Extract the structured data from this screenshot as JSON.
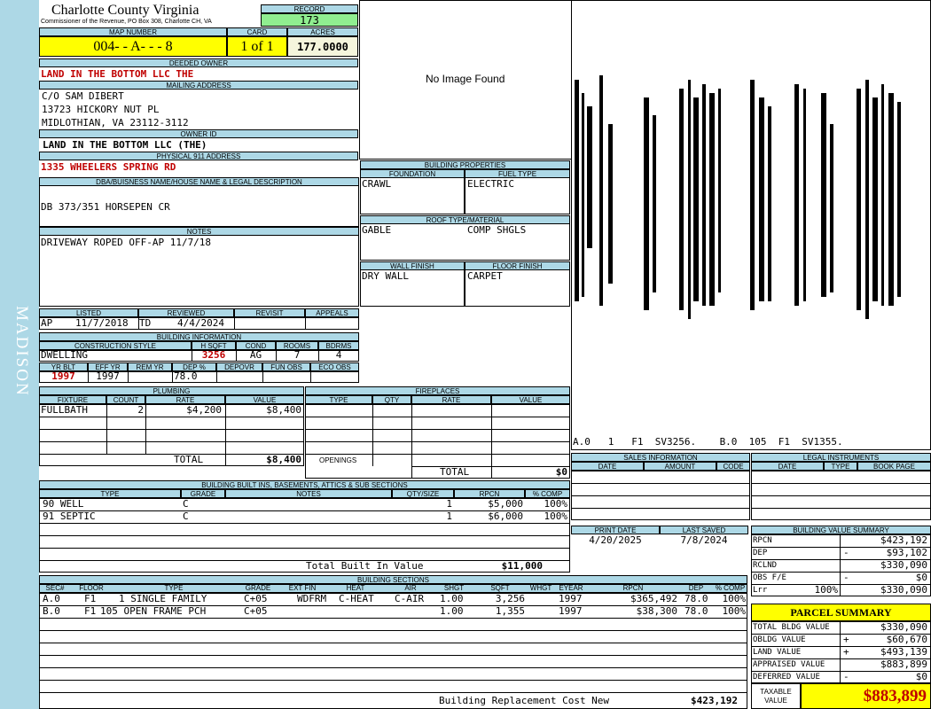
{
  "sidebar_label": "MADISON",
  "header": {
    "county": "Charlotte County Virginia",
    "commissioner": "Commissioner of the Revenue, PO Box 308, Charlotte CH, VA",
    "record_label": "RECORD",
    "record": "173",
    "map_number_label": "MAP NUMBER",
    "map_number": "004-  - A-  -  -  8",
    "card_label": "CARD",
    "card": "1 of 1",
    "acres_label": "ACRES",
    "acres": "177.0000"
  },
  "owner": {
    "deeded_owner_label": "DEEDED OWNER",
    "deeded_owner": "LAND IN THE BOTTOM LLC  THE",
    "mailing_address_label": "MAILING ADDRESS",
    "mailing_lines": [
      "C/O SAM DIBERT",
      "13723 HICKORY NUT PL",
      "MIDLOTHIAN, VA 23112-3112"
    ],
    "owner_id_label": "OWNER ID",
    "owner_id": "LAND IN THE BOTTOM LLC (THE)",
    "physical_address_label": "PHYSICAL 911 ADDRESS",
    "physical_address": "1335 WHEELERS SPRING RD",
    "dba_label": "DBA/BUISNESS NAME/HOUSE NAME & LEGAL DESCRIPTION",
    "dba": "DB 373/351 HORSEPEN CR",
    "notes_label": "NOTES",
    "notes": "DRIVEWAY ROPED OFF-AP 11/7/18"
  },
  "image_placeholder": "No Image Found",
  "building_properties": {
    "label": "BUILDING PROPERTIES",
    "foundation_label": "FOUNDATION",
    "foundation": "CRAWL",
    "fuel_label": "FUEL TYPE",
    "fuel": "ELECTRIC",
    "roof_label": "ROOF TYPE/MATERIAL",
    "roof_type": "GABLE",
    "roof_material": "COMP SHGLS",
    "wall_label": "WALL FINISH",
    "wall": "DRY WALL",
    "floor_label": "FLOOR FINISH",
    "floor": "CARPET"
  },
  "sketch_caption": "A.0   1   F1  SV3256.    B.0  105  F1  SV1355.",
  "listing": {
    "listed_label": "LISTED",
    "listed_by": "AP",
    "listed_date": "11/7/2018",
    "reviewed_label": "REVIEWED",
    "reviewed_by": "TD",
    "reviewed_date": "4/4/2024",
    "revisit_label": "REVISIT",
    "appeals_label": "APPEALS"
  },
  "building_info": {
    "label": "BUILDING INFORMATION",
    "style_label": "CONSTRUCTION STYLE",
    "style": "DWELLING",
    "hsqft_label": "H SQFT",
    "hsqft": "3256",
    "cond_label": "COND",
    "cond": "AG",
    "rooms_label": "ROOMS",
    "rooms": "7",
    "bdrms_label": "BDRMS",
    "bdrms": "4",
    "yrblt_label": "YR BLT",
    "yrblt": "1997",
    "effyr_label": "EFF YR",
    "effyr": "1997",
    "remyr_label": "REM YR",
    "remyr": "",
    "dep_label": "DEP %",
    "dep": "78.0",
    "depovr_label": "DEPOVR",
    "funobs_label": "FUN OBS",
    "ecoobs_label": "ECO OBS"
  },
  "plumbing": {
    "label": "PLUMBING",
    "headers": [
      "FIXTURE",
      "COUNT",
      "RATE",
      "VALUE"
    ],
    "rows": [
      [
        "FULLBATH",
        "2",
        "$4,200",
        "$8,400"
      ]
    ],
    "total_label": "TOTAL",
    "total": "$8,400"
  },
  "fireplaces": {
    "label": "FIREPLACES",
    "headers": [
      "TYPE",
      "QTY",
      "RATE",
      "VALUE"
    ],
    "openings_label": "OPENINGS",
    "total_label": "TOTAL",
    "total": "$0"
  },
  "sales": {
    "label": "SALES INFORMATION",
    "headers": [
      "DATE",
      "AMOUNT",
      "CODE"
    ]
  },
  "legal": {
    "label": "LEGAL INSTRUMENTS",
    "headers": [
      "DATE",
      "TYPE",
      "BOOK PAGE"
    ]
  },
  "dates": {
    "print_label": "PRINT DATE",
    "print_date": "4/20/2025",
    "saved_label": "LAST SAVED",
    "saved_date": "7/8/2024"
  },
  "built_ins": {
    "label": "BUILDING BUILT INS, BASEMENTS, ATTICS & SUB SECTIONS",
    "headers": [
      "TYPE",
      "GRADE",
      "NOTES",
      "QTY/SIZE",
      "RPCN",
      "% COMP"
    ],
    "rows": [
      [
        "90 WELL",
        "C",
        "",
        "1",
        "$5,000",
        "100%"
      ],
      [
        "91 SEPTIC",
        "C",
        "",
        "1",
        "$6,000",
        "100%"
      ]
    ],
    "total_label": "Total Built In Value",
    "total": "$11,000"
  },
  "value_summary": {
    "label": "BUILDING VALUE SUMMARY",
    "rows": [
      {
        "name": "RPCN",
        "pct": "",
        "sign": "",
        "value": "$423,192"
      },
      {
        "name": "DEP",
        "pct": "",
        "sign": "-",
        "value": "$93,102"
      },
      {
        "name": "RCLND",
        "pct": "",
        "sign": "",
        "value": "$330,090"
      },
      {
        "name": "OBS F/E",
        "pct": "",
        "sign": "-",
        "value": "$0"
      },
      {
        "name": "Lrr",
        "pct": "100%",
        "sign": "",
        "value": "$330,090"
      }
    ]
  },
  "sections": {
    "label": "BUILDING SECTIONS",
    "headers": [
      "SEC#",
      "FLOOR",
      "TYPE",
      "GRADE",
      "EXT FIN",
      "HEAT",
      "AIR",
      "SHGT",
      "SQFT",
      "WHGT",
      "EYEAR",
      "RPCN",
      "DEP",
      "% COMP"
    ],
    "rows": [
      [
        "A.0",
        "F1",
        "1 SINGLE FAMILY",
        "C+05",
        "WDFRM",
        "C-HEAT",
        "C-AIR",
        "1.00",
        "3,256",
        "",
        "1997",
        "$365,492",
        "78.0",
        "100%"
      ],
      [
        "B.0",
        "F1",
        "105 OPEN FRAME PCH",
        "C+05",
        "",
        "",
        "",
        "1.00",
        "1,355",
        "",
        "1997",
        "$38,300",
        "78.0",
        "100%"
      ]
    ],
    "total_label": "Building Replacement Cost New",
    "total": "$423,192"
  },
  "parcel_summary": {
    "label": "PARCEL SUMMARY",
    "rows": [
      {
        "name": "TOTAL BLDG VALUE",
        "sign": "",
        "value": "$330,090"
      },
      {
        "name": "OBLDG VALUE",
        "sign": "+",
        "value": "$60,670"
      },
      {
        "name": "LAND VALUE",
        "sign": "+",
        "value": "$493,139"
      },
      {
        "name": "APPRAISED VALUE",
        "sign": "",
        "value": "$883,899"
      },
      {
        "name": "DEFERRED VALUE",
        "sign": "-",
        "value": "$0"
      }
    ],
    "taxable_label": "TAXABLE VALUE",
    "taxable": "$883,899"
  },
  "colors": {
    "label_bg": "#add8e6",
    "highlight_yellow": "#ffff00",
    "record_green": "#90ee90",
    "acres_bg": "#f5f5dc",
    "red_text": "#c00000"
  }
}
